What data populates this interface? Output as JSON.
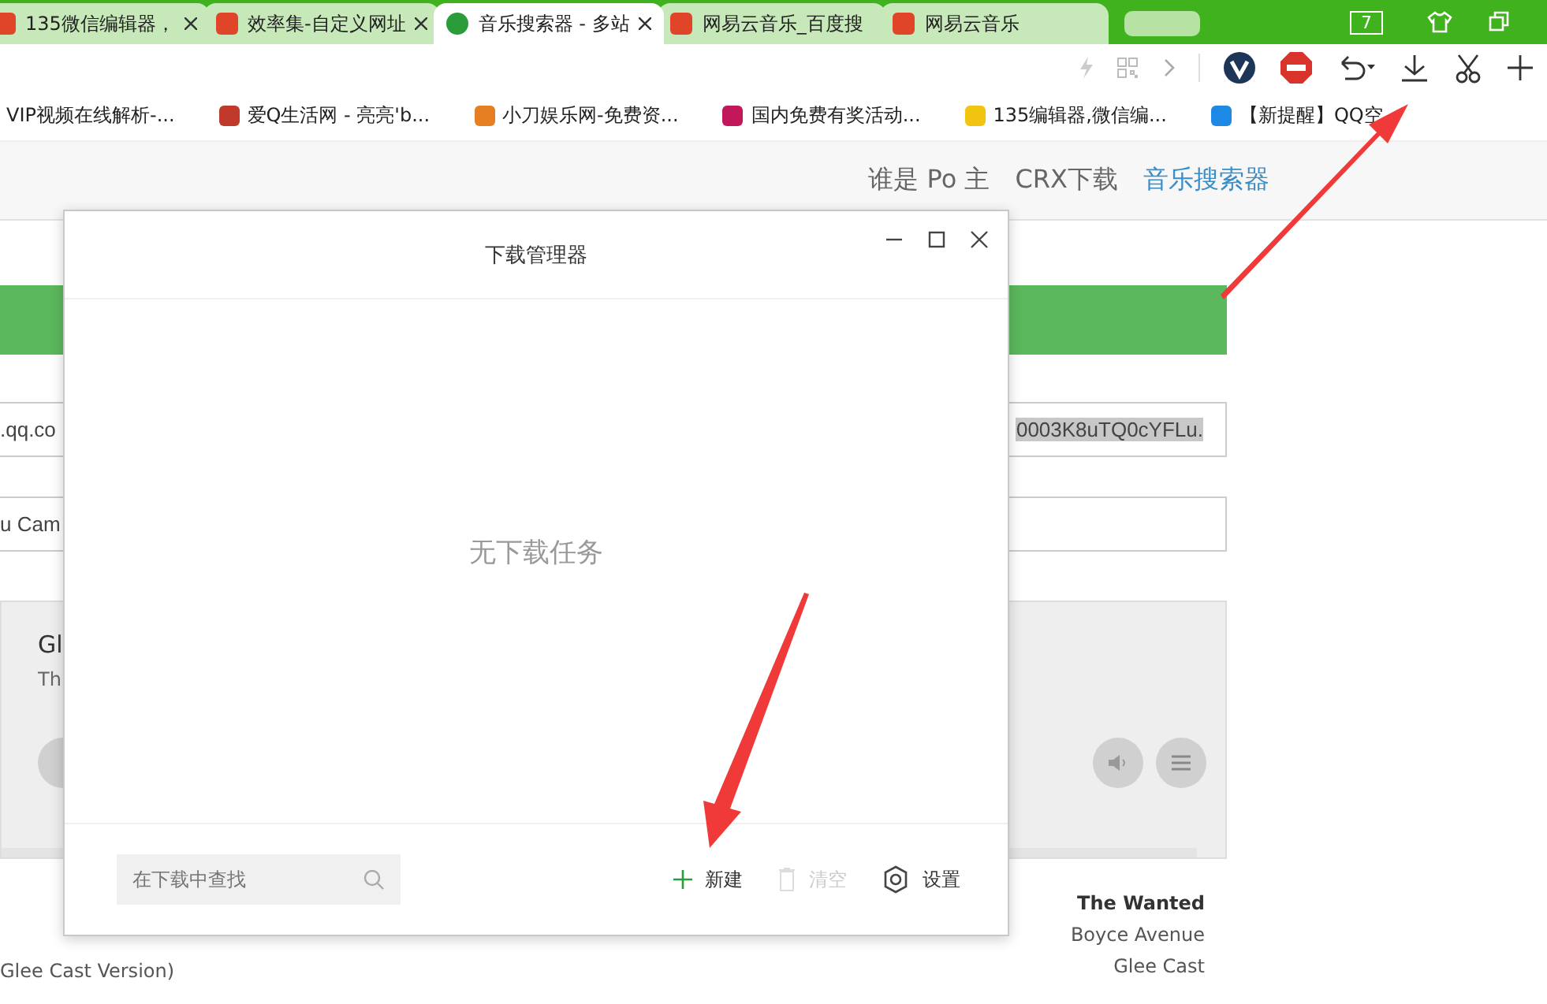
{
  "tabs": [
    {
      "label": "135微信编辑器，",
      "selected": false
    },
    {
      "label": "效率集-自定义网址",
      "selected": false
    },
    {
      "label": "音乐搜索器 - 多站",
      "selected": true
    },
    {
      "label": "网易云音乐_百度搜",
      "selected": false
    },
    {
      "label": "网易云音乐",
      "selected": false
    }
  ],
  "tab_count": "7",
  "bookmarks": [
    "VIP视频在线解析-...",
    "爱Q生活网 - 亮亮'b...",
    "小刀娱乐网-免费资...",
    "国内免费有奖活动...",
    "135编辑器,微信编...",
    "【新提醒】QQ空"
  ],
  "site_nav": [
    {
      "label": "谁是 Po 主",
      "selected": false
    },
    {
      "label": "CRX下载",
      "selected": false
    },
    {
      "label": "音乐搜索器",
      "selected": true
    }
  ],
  "url_field": {
    "value": ".qq.co",
    "selected_text": "0003K8uTQ0cYFLu."
  },
  "title_field": {
    "value": "u Cam"
  },
  "player": {
    "title": "Gl",
    "artist": "Th"
  },
  "song_list": [
    {
      "text": "The Wanted",
      "bold": true
    },
    {
      "text": "Boyce Avenue",
      "bold": false
    },
    {
      "text": "Glee Cast",
      "bold": false
    }
  ],
  "song_caption": "Glee Cast Version)",
  "dialog": {
    "title": "下载管理器",
    "empty_text": "无下载任务",
    "search": {
      "placeholder": "在下载中查找"
    },
    "actions": [
      {
        "kind": "new",
        "label": "新建",
        "disabled": false
      },
      {
        "kind": "clear",
        "label": "清空",
        "disabled": true
      },
      {
        "kind": "settings",
        "label": "设置",
        "disabled": false
      }
    ]
  }
}
